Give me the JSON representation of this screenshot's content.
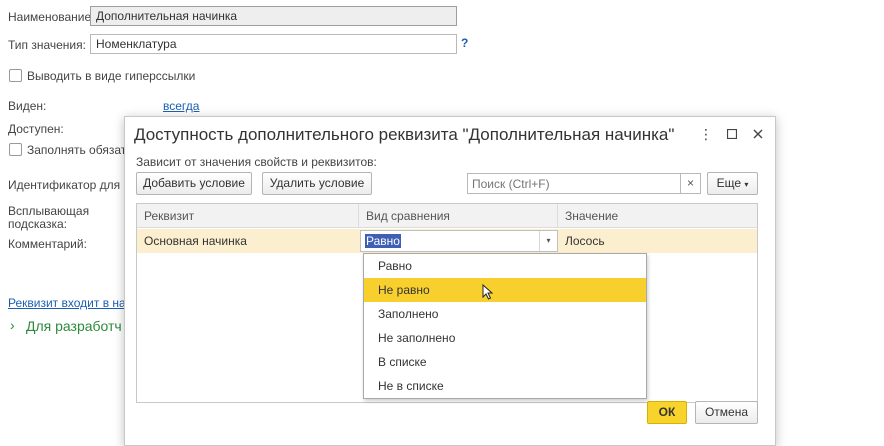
{
  "background_form": {
    "name_label": "Наименование:",
    "name_value": "Дополнительная начинка",
    "type_label": "Тип значения:",
    "type_value": "Номенклатура",
    "help_mark": "?",
    "hyperlink_checkbox_label": "Выводить в виде гиперссылки",
    "visible_label": "Виден:",
    "visible_value": "всегда",
    "available_label": "Доступен:",
    "fill_checkbox_label": "Заполнять обязате",
    "identifier_label": "Идентификатор для ф",
    "tooltip_label_line1": "Всплывающая",
    "tooltip_label_line2": "подсказка:",
    "comment_label": "Комментарий:",
    "set_link": "Реквизит входит в наб",
    "developers_section": "Для разработч"
  },
  "dialog": {
    "title": "Доступность дополнительного реквизита \"Дополнительная начинка\"",
    "subtitle": "Зависит от значения свойств и реквизитов:",
    "add_button": "Добавить условие",
    "delete_button": "Удалить условие",
    "search_placeholder": "Поиск (Ctrl+F)",
    "clear_search": "×",
    "more_button": "Еще",
    "menu_icon": "more-vertical-icon",
    "maximize_icon": "maximize-icon",
    "close_icon": "close-icon",
    "columns": [
      "Реквизит",
      "Вид сравнения",
      "Значение"
    ],
    "row": {
      "attribute": "Основная начинка",
      "comparison": "Равно",
      "value": "Лосось"
    },
    "dropdown_options": [
      "Равно",
      "Не равно",
      "Заполнено",
      "Не заполнено",
      "В списке",
      "Не в списке"
    ],
    "highlighted_option": "Не равно",
    "ok_button": "ОК",
    "cancel_button": "Отмена"
  },
  "colors": {
    "ok_button": "#f7d32b",
    "highlight": "#f8d02e",
    "selected_row": "#fbefd0",
    "link": "#1b5fb2",
    "section_green": "#2c8a3c"
  }
}
